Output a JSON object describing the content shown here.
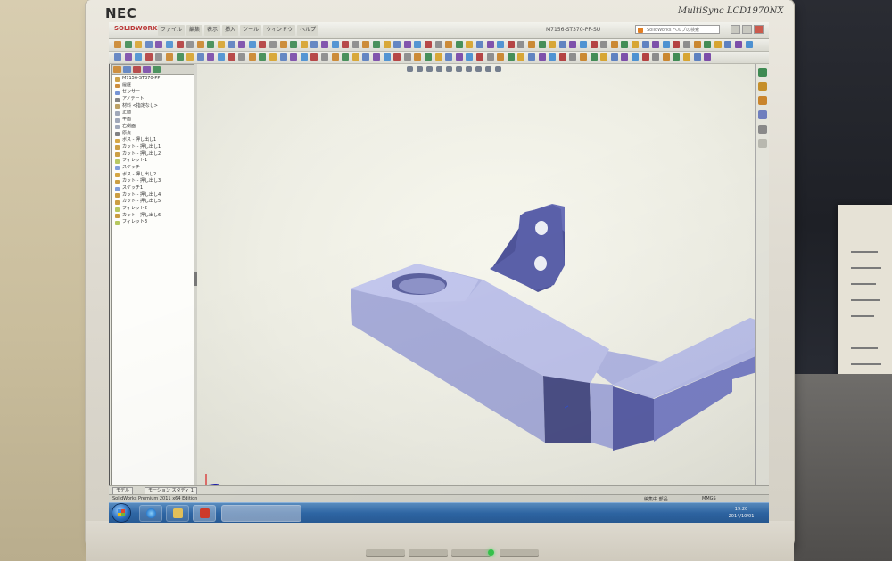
{
  "monitor": {
    "brand": "NEC",
    "model": "MultiSync LCD1970NX"
  },
  "app": {
    "logo": "SOLIDWORKS",
    "document_title": "M7156-ST370-PP-SU",
    "search_placeholder": "SolidWorks ヘルプの検索",
    "menus": [
      "ファイル",
      "編集",
      "表示",
      "挿入",
      "ツール",
      "ウィンドウ",
      "ヘルプ"
    ]
  },
  "feature_tree": {
    "part_name": "M7156-ST370-PP",
    "items": [
      "履歴",
      "センサー",
      "アノテート",
      "材料 <指定なし>",
      "正面",
      "平面",
      "右側面",
      "原点",
      "ボス - 押し出し1",
      "カット - 押し出し1",
      "カット - 押し出し2",
      "フィレット1",
      "スケッチ",
      "ボス - 押し出し2",
      "カット - 押し出し3",
      "スケッチ1",
      "カット - 押し出し4",
      "カット - 押し出し5",
      "フィレット2",
      "カット - 押し出し6",
      "フィレット3"
    ]
  },
  "sheet_tabs": [
    "モデル",
    "モーション スタディ 1"
  ],
  "status": {
    "left": "SolidWorks Premium 2011 x64 Edition",
    "units": "編集中 部品",
    "unit_system": "MMGS"
  },
  "taskbar": {
    "clock_time": "19:20",
    "clock_date": "2014/10/01"
  },
  "icons": {
    "start": "windows-start-icon",
    "ie": "internet-explorer-icon",
    "explorer": "folder-icon",
    "solidworks": "solidworks-icon"
  },
  "colors": {
    "part_face_light": "#b8bde8",
    "part_face_mid": "#8c92cf",
    "part_face_dark": "#4b5096",
    "viewport_bg": "#f4f4ea",
    "taskbar": "#2f68a8"
  }
}
